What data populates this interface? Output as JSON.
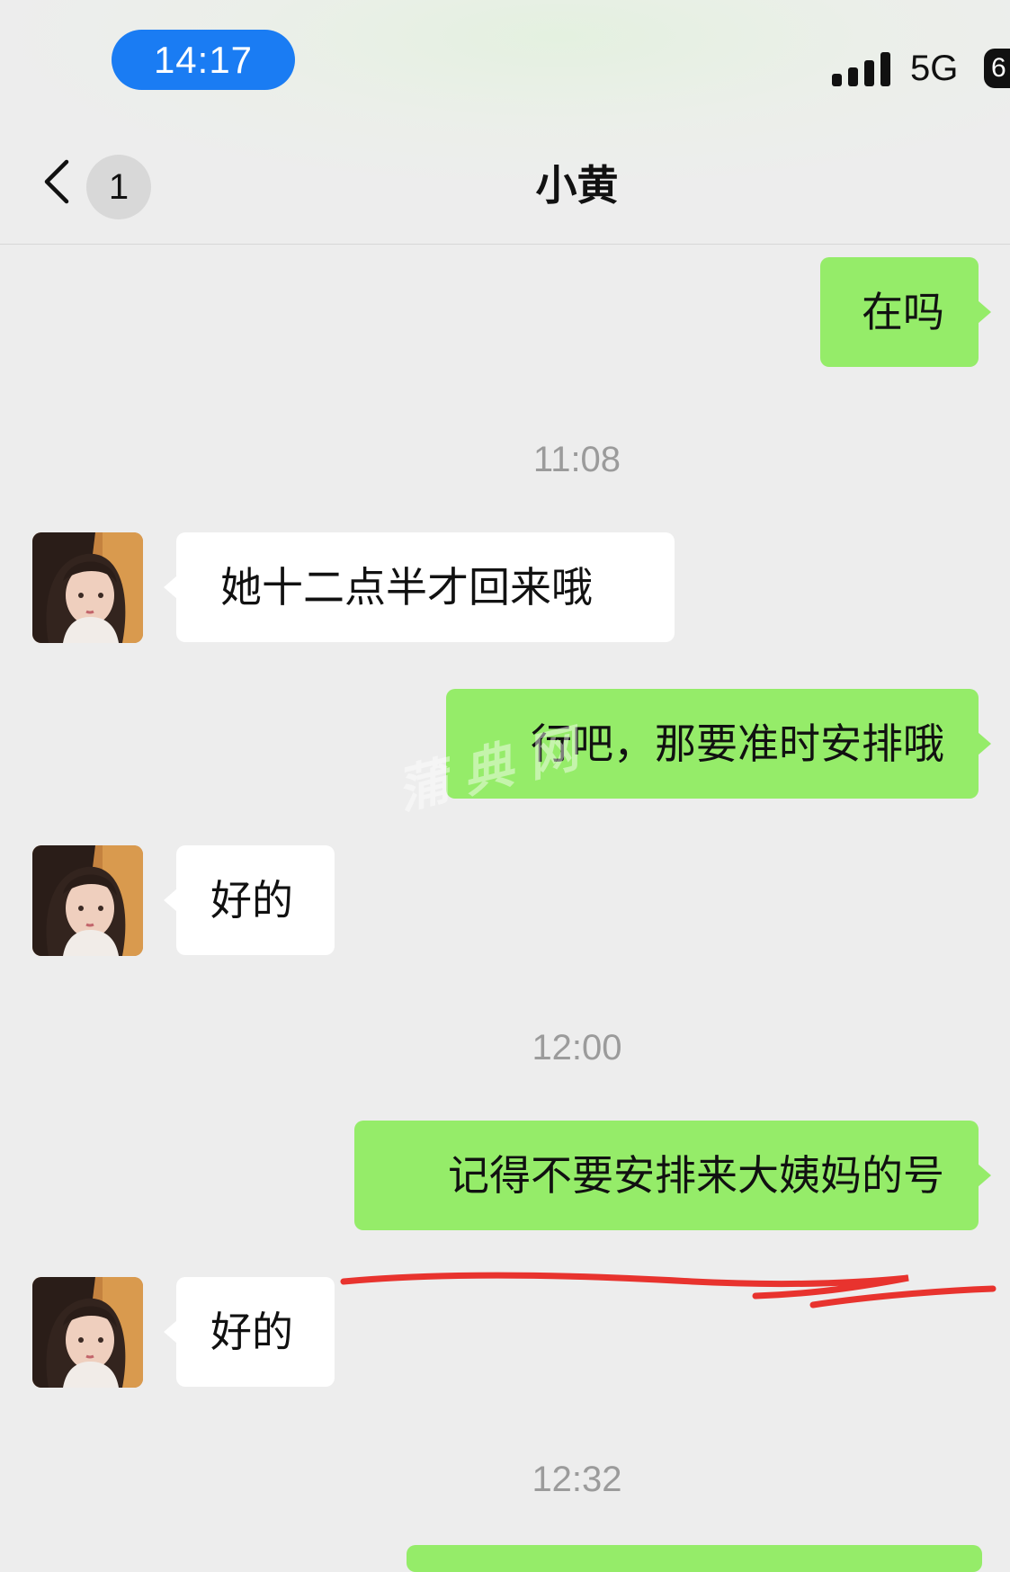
{
  "status_bar": {
    "time": "14:17",
    "network": "5G",
    "battery_level": "6",
    "signal_bars": 4
  },
  "nav": {
    "back_icon": "chevron-left-icon",
    "unread_count": "1",
    "title": "小黄"
  },
  "messages": [
    {
      "type": "outgoing",
      "text": "在吗"
    },
    {
      "type": "timestamp",
      "text": "11:08"
    },
    {
      "type": "incoming",
      "text": "她十二点半才回来哦"
    },
    {
      "type": "outgoing",
      "text": "行吧，那要准时安排哦"
    },
    {
      "type": "incoming",
      "text": "好的"
    },
    {
      "type": "timestamp",
      "text": "12:00"
    },
    {
      "type": "outgoing",
      "text": "记得不要安排来大姨妈的号"
    },
    {
      "type": "incoming",
      "text": "好的"
    },
    {
      "type": "timestamp",
      "text": "12:32"
    }
  ],
  "watermark": "蒲典网",
  "colors": {
    "background": "#ededed",
    "outgoing_bubble": "#95ec69",
    "incoming_bubble": "#ffffff",
    "time_pill": "#1a7cf3",
    "timestamp_text": "#9b9b9b",
    "annotation_line": "#e8332e"
  }
}
